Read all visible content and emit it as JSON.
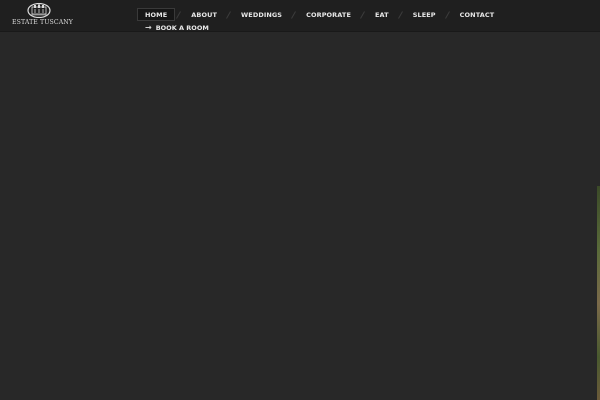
{
  "brand": {
    "name": "ESTATE TUSCANY",
    "logo_icon": "estate-emblem-icon"
  },
  "nav": {
    "items": [
      {
        "label": "HOME",
        "active": true
      },
      {
        "label": "ABOUT",
        "active": false
      },
      {
        "label": "WEDDINGS",
        "active": false
      },
      {
        "label": "CORPORATE",
        "active": false
      },
      {
        "label": "EAT",
        "active": false
      },
      {
        "label": "SLEEP",
        "active": false
      },
      {
        "label": "CONTACT",
        "active": false
      }
    ],
    "book": {
      "label": "BOOK A ROOM",
      "icon": "arrow-right-icon"
    }
  },
  "colors": {
    "background": "#282828",
    "header": "#1f1f1f",
    "text": "#e8e8e8"
  }
}
